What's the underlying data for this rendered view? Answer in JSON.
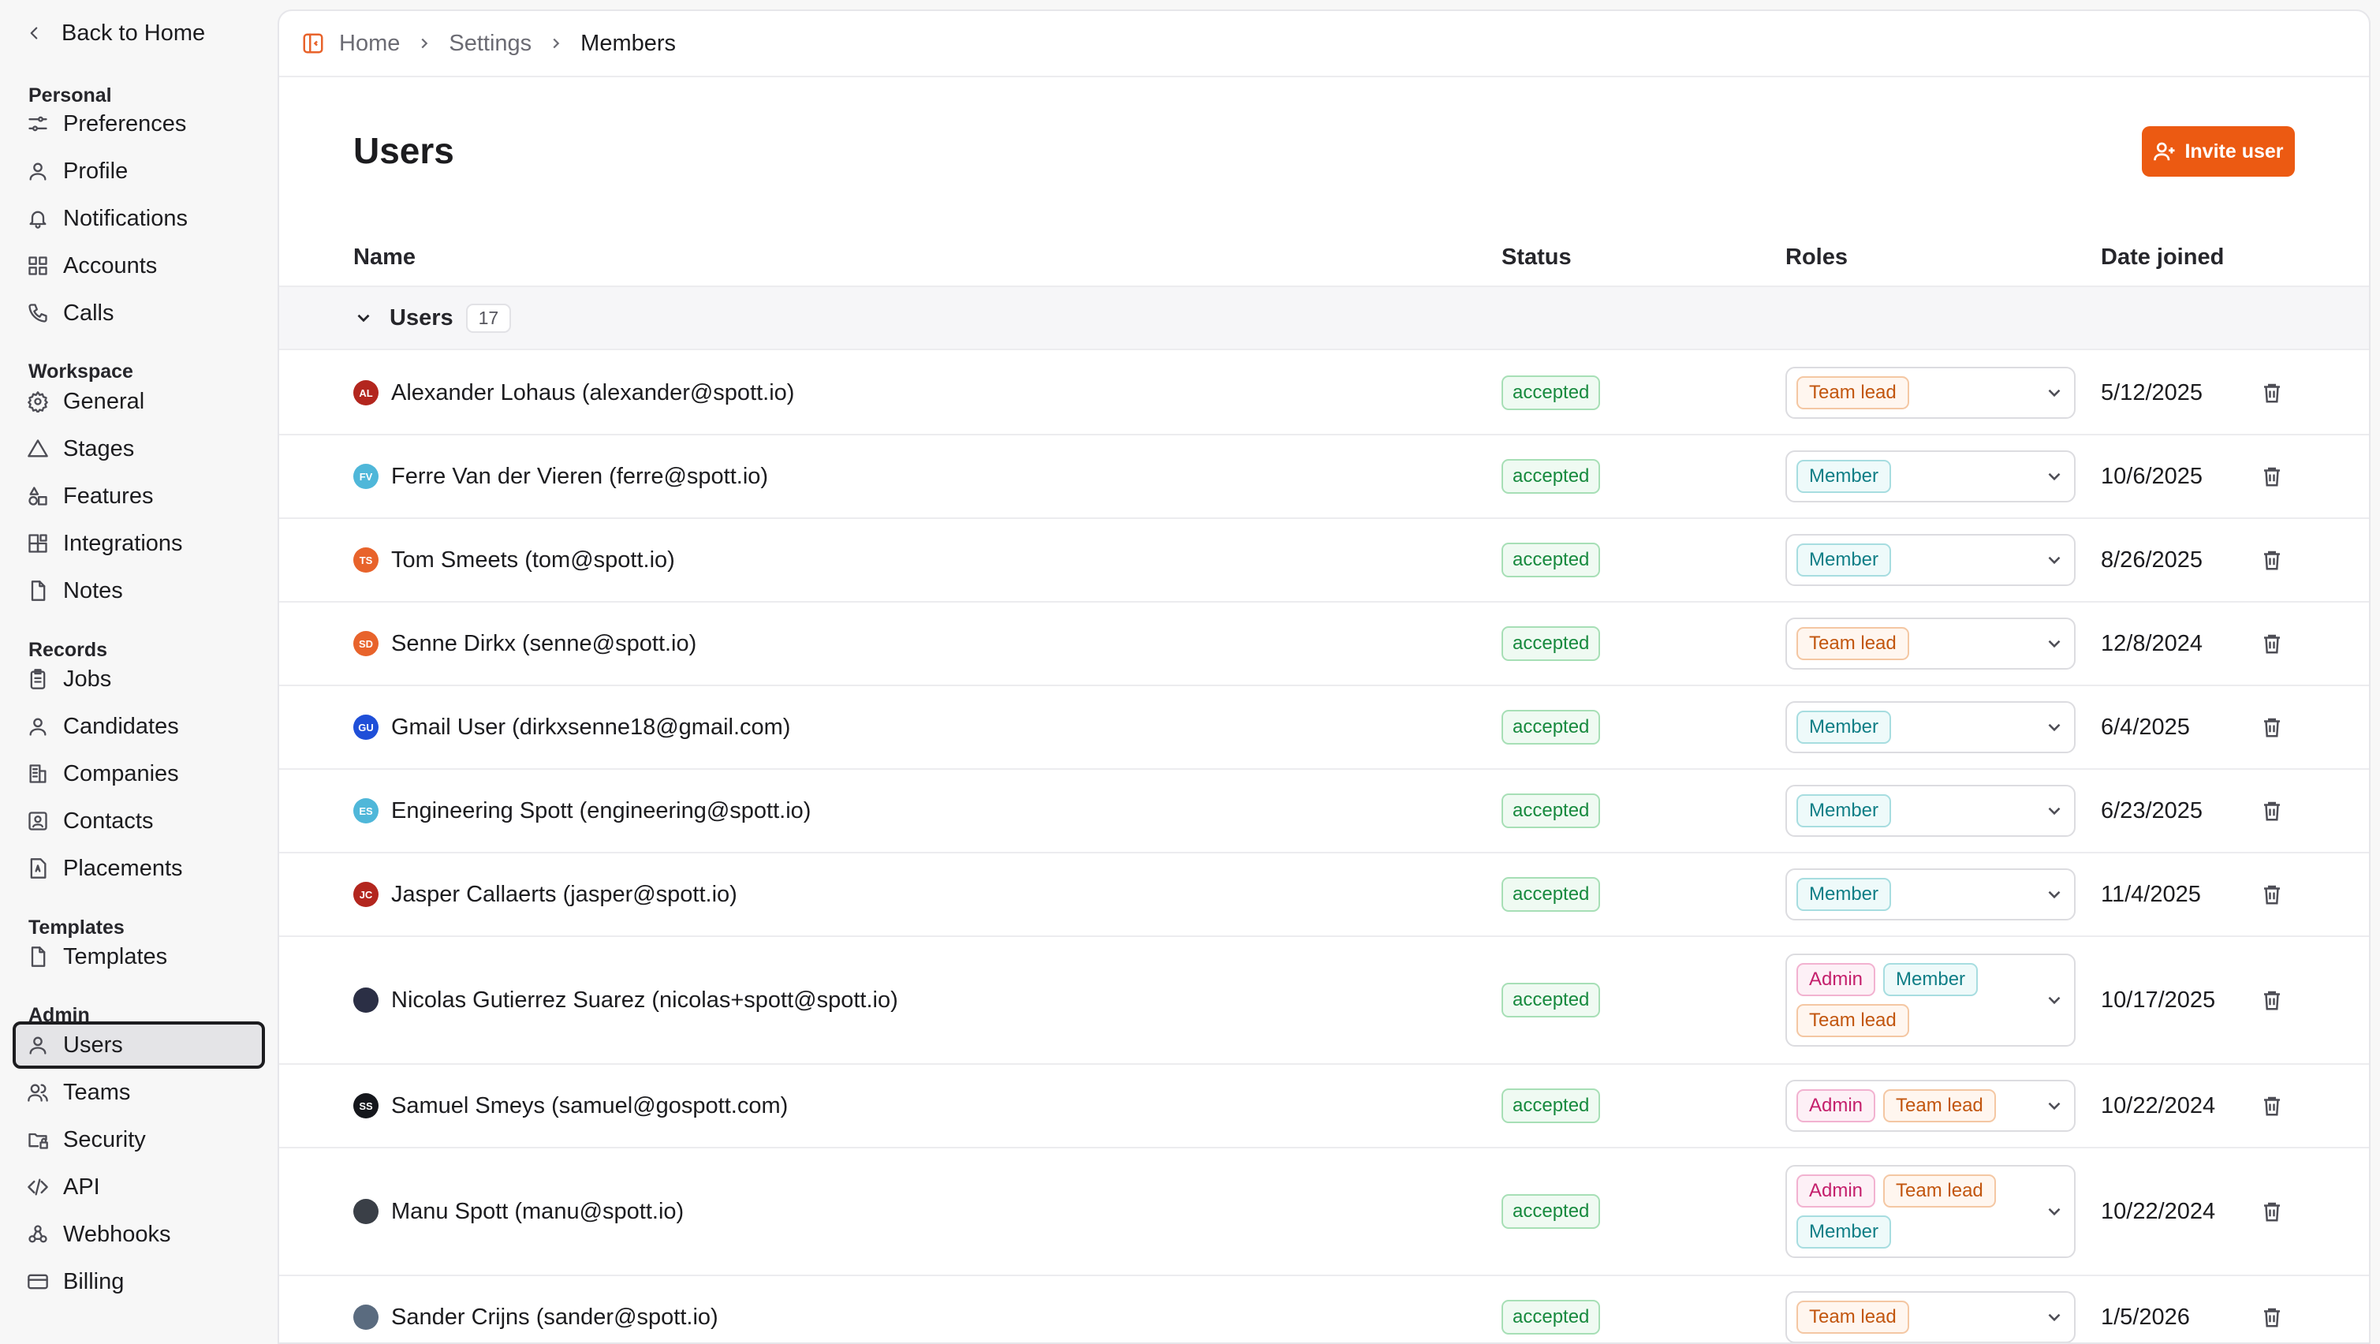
{
  "sidebar": {
    "back_label": "Back to Home",
    "sections": [
      {
        "title": "Personal",
        "items": [
          {
            "label": "Preferences",
            "icon": "sliders-icon"
          },
          {
            "label": "Profile",
            "icon": "user-icon"
          },
          {
            "label": "Notifications",
            "icon": "bell-icon"
          },
          {
            "label": "Accounts",
            "icon": "grid-icon"
          },
          {
            "label": "Calls",
            "icon": "phone-icon"
          }
        ]
      },
      {
        "title": "Workspace",
        "items": [
          {
            "label": "General",
            "icon": "gear-icon"
          },
          {
            "label": "Stages",
            "icon": "triangle-icon"
          },
          {
            "label": "Features",
            "icon": "shapes-icon"
          },
          {
            "label": "Integrations",
            "icon": "blocks-icon"
          },
          {
            "label": "Notes",
            "icon": "file-icon"
          }
        ]
      },
      {
        "title": "Records",
        "items": [
          {
            "label": "Jobs",
            "icon": "clipboard-icon"
          },
          {
            "label": "Candidates",
            "icon": "user-icon"
          },
          {
            "label": "Companies",
            "icon": "building-icon"
          },
          {
            "label": "Contacts",
            "icon": "contact-icon"
          },
          {
            "label": "Placements",
            "icon": "badge-icon"
          }
        ]
      },
      {
        "title": "Templates",
        "items": [
          {
            "label": "Templates",
            "icon": "file-icon"
          }
        ]
      },
      {
        "title": "Admin",
        "items": [
          {
            "label": "Users",
            "icon": "user-icon",
            "active": true
          },
          {
            "label": "Teams",
            "icon": "users-icon"
          },
          {
            "label": "Security",
            "icon": "folder-lock-icon"
          },
          {
            "label": "API",
            "icon": "code-icon"
          },
          {
            "label": "Webhooks",
            "icon": "webhook-icon"
          },
          {
            "label": "Billing",
            "icon": "credit-card-icon"
          }
        ]
      }
    ]
  },
  "breadcrumb": [
    "Home",
    "Settings",
    "Members"
  ],
  "page": {
    "title": "Users",
    "invite_label": "Invite user"
  },
  "columns": {
    "name": "Name",
    "status": "Status",
    "roles": "Roles",
    "date": "Date joined"
  },
  "group": {
    "label": "Users",
    "count": "17"
  },
  "users": [
    {
      "initials": "AL",
      "color": "#b3261e",
      "name": "Alexander Lohaus (alexander@spott.io)",
      "status": "accepted",
      "roles": [
        "Team lead"
      ],
      "date": "5/12/2025"
    },
    {
      "initials": "FV",
      "color": "#4fb7d9",
      "name": "Ferre Van der Vieren (ferre@spott.io)",
      "status": "accepted",
      "roles": [
        "Member"
      ],
      "date": "10/6/2025"
    },
    {
      "initials": "TS",
      "color": "#e8632b",
      "name": "Tom Smeets (tom@spott.io)",
      "status": "accepted",
      "roles": [
        "Member"
      ],
      "date": "8/26/2025"
    },
    {
      "initials": "SD",
      "color": "#e8632b",
      "name": "Senne Dirkx (senne@spott.io)",
      "status": "accepted",
      "roles": [
        "Team lead"
      ],
      "date": "12/8/2024"
    },
    {
      "initials": "GU",
      "color": "#1f4fd8",
      "name": "Gmail User (dirkxsenne18@gmail.com)",
      "status": "accepted",
      "roles": [
        "Member"
      ],
      "date": "6/4/2025"
    },
    {
      "initials": "ES",
      "color": "#4fb7d9",
      "name": "Engineering Spott (engineering@spott.io)",
      "status": "accepted",
      "roles": [
        "Member"
      ],
      "date": "6/23/2025"
    },
    {
      "initials": "JC",
      "color": "#b3261e",
      "name": "Jasper Callaerts (jasper@spott.io)",
      "status": "accepted",
      "roles": [
        "Member"
      ],
      "date": "11/4/2025"
    },
    {
      "initials": "",
      "color": "#2b2f45",
      "name": "Nicolas Gutierrez Suarez (nicolas+spott@spott.io)",
      "status": "accepted",
      "roles": [
        "Admin",
        "Member",
        "Team lead"
      ],
      "date": "10/17/2025"
    },
    {
      "initials": "SS",
      "color": "#15171c",
      "name": "Samuel Smeys (samuel@gospott.com)",
      "status": "accepted",
      "roles": [
        "Admin",
        "Team lead"
      ],
      "date": "10/22/2024"
    },
    {
      "initials": "",
      "color": "#3a3f47",
      "name": "Manu Spott (manu@spott.io)",
      "status": "accepted",
      "roles": [
        "Admin",
        "Team lead",
        "Member"
      ],
      "date": "10/22/2024"
    },
    {
      "initials": "",
      "color": "#5a6b7f",
      "name": "Sander Crijns (sander@spott.io)",
      "status": "accepted",
      "roles": [
        "Team lead"
      ],
      "date": "1/5/2026"
    }
  ]
}
